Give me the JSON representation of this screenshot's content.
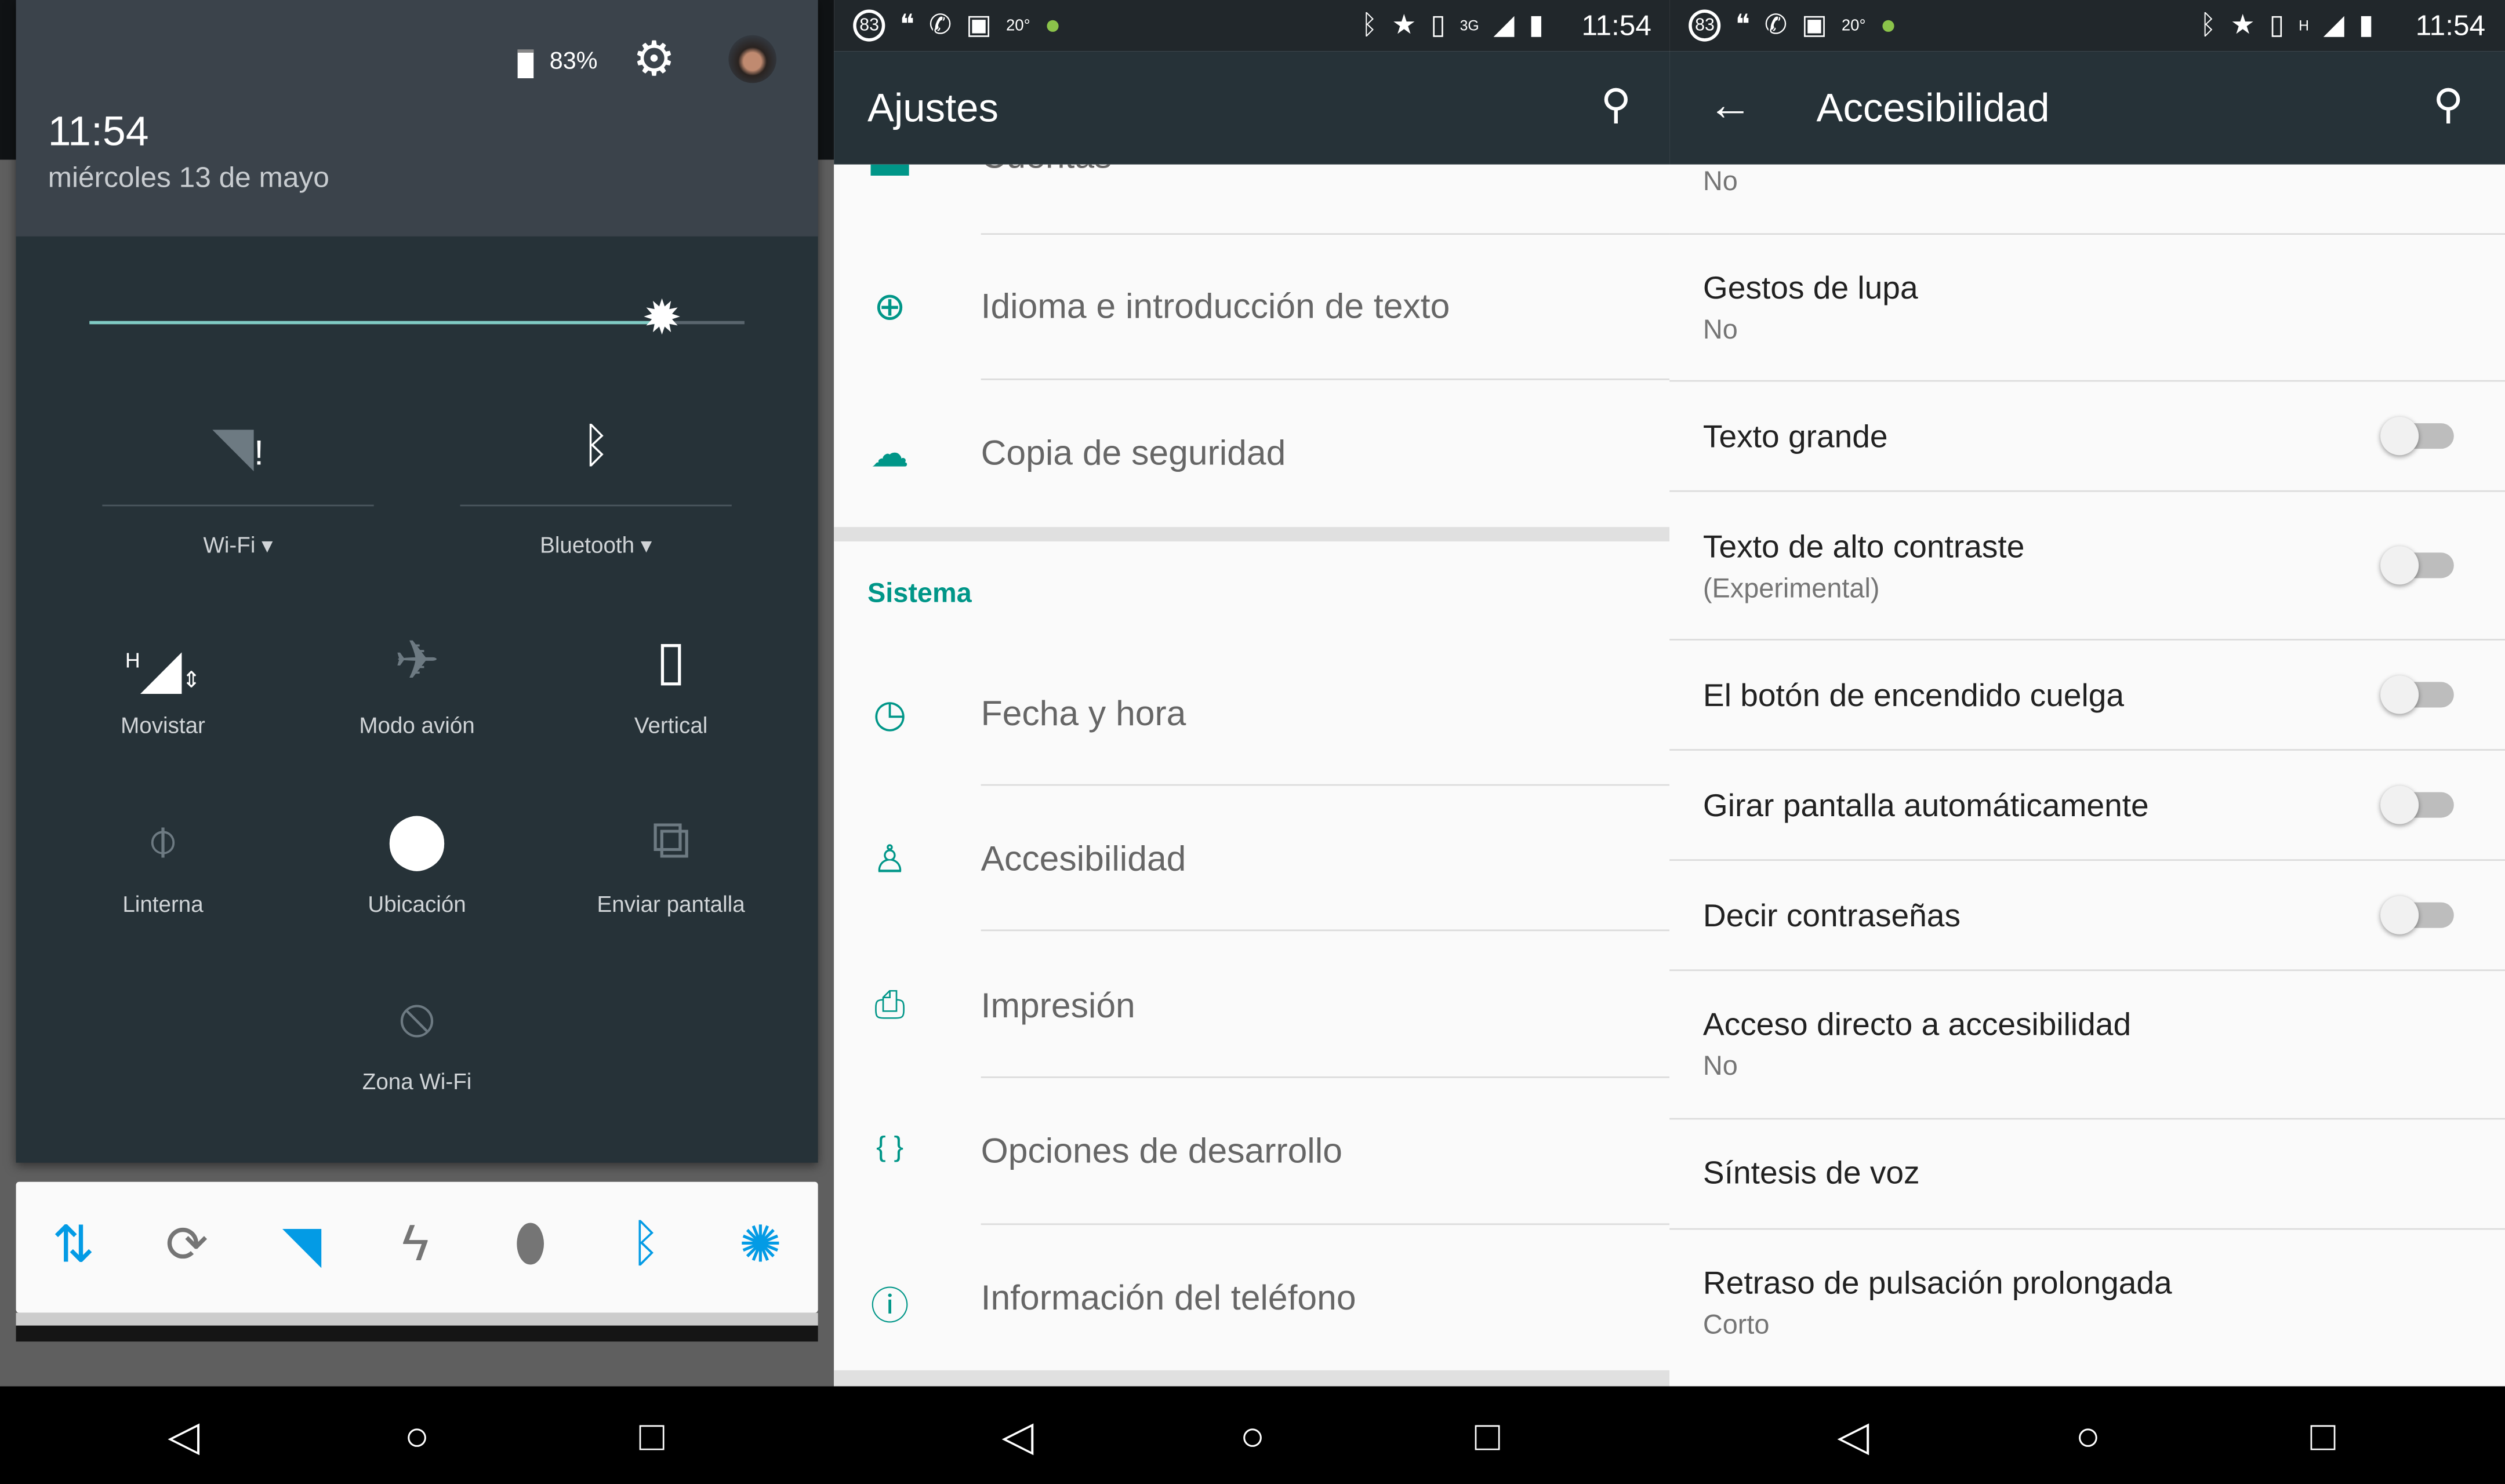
{
  "shade": {
    "battery": "83%",
    "time": "11:54",
    "date": "miércoles 13 de mayo",
    "brightness": 0.88,
    "tiles": [
      {
        "label": "Wi-Fi",
        "icon": "wifi-alert-icon",
        "dropdown": true
      },
      {
        "label": "Bluetooth",
        "icon": "bluetooth-icon",
        "dropdown": true
      },
      {
        "label": "Movistar",
        "icon": "signal-h-icon"
      },
      {
        "label": "Modo avión",
        "icon": "airplane-icon"
      },
      {
        "label": "Vertical",
        "icon": "phone-portrait-icon"
      },
      {
        "label": "Linterna",
        "icon": "flashlight-off-icon"
      },
      {
        "label": "Ubicación",
        "icon": "location-icon"
      },
      {
        "label": "Enviar pantalla",
        "icon": "cast-icon"
      },
      {
        "label": "Zona Wi-Fi",
        "icon": "hotspot-off-icon"
      }
    ],
    "widget": [
      {
        "icon": "data-icon",
        "color": "#039be5"
      },
      {
        "icon": "sync-icon",
        "color": "#757575"
      },
      {
        "icon": "wifi-icon",
        "color": "#039be5"
      },
      {
        "icon": "flash-icon",
        "color": "#757575"
      },
      {
        "icon": "location-icon",
        "color": "#757575"
      },
      {
        "icon": "bluetooth-icon",
        "color": "#039be5"
      },
      {
        "icon": "auto-brightness-icon",
        "color": "#039be5"
      }
    ]
  },
  "statusbar": {
    "time": "11:54",
    "notif_count": "83",
    "temp": "20°",
    "network_mid": "3G",
    "network_right": "H"
  },
  "settings": {
    "title": "Ajustes",
    "partial_item": "Cuentas",
    "items_top": [
      {
        "label": "Idioma e introducción de texto",
        "icon": "globe-icon"
      },
      {
        "label": "Copia de seguridad",
        "icon": "cloud-upload-icon"
      }
    ],
    "section": "Sistema",
    "items": [
      {
        "label": "Fecha y hora",
        "icon": "clock-icon"
      },
      {
        "label": "Accesibilidad",
        "icon": "accessibility-icon"
      },
      {
        "label": "Impresión",
        "icon": "print-icon"
      },
      {
        "label": "Opciones de desarrollo",
        "icon": "braces-icon"
      },
      {
        "label": "Información del teléfono",
        "icon": "info-icon"
      }
    ]
  },
  "accessibility": {
    "title": "Accesibilidad",
    "partial_sub": "No",
    "items": [
      {
        "title": "Gestos de lupa",
        "sub": "No"
      },
      {
        "title": "Texto grande",
        "toggle": false
      },
      {
        "title": "Texto de alto contraste",
        "sub": "(Experimental)",
        "toggle": false
      },
      {
        "title": "El botón de encendido cuelga",
        "toggle": false
      },
      {
        "title": "Girar pantalla automáticamente",
        "toggle": false
      },
      {
        "title": "Decir contraseñas",
        "toggle": false
      },
      {
        "title": "Acceso directo a accesibilidad",
        "sub": "No"
      },
      {
        "title": "Síntesis de voz"
      },
      {
        "title": "Retraso de pulsación prolongada",
        "sub": "Corto"
      }
    ]
  },
  "colors": {
    "accent": "#009688",
    "toolbar": "#263238",
    "statusbar": "#21272b"
  }
}
